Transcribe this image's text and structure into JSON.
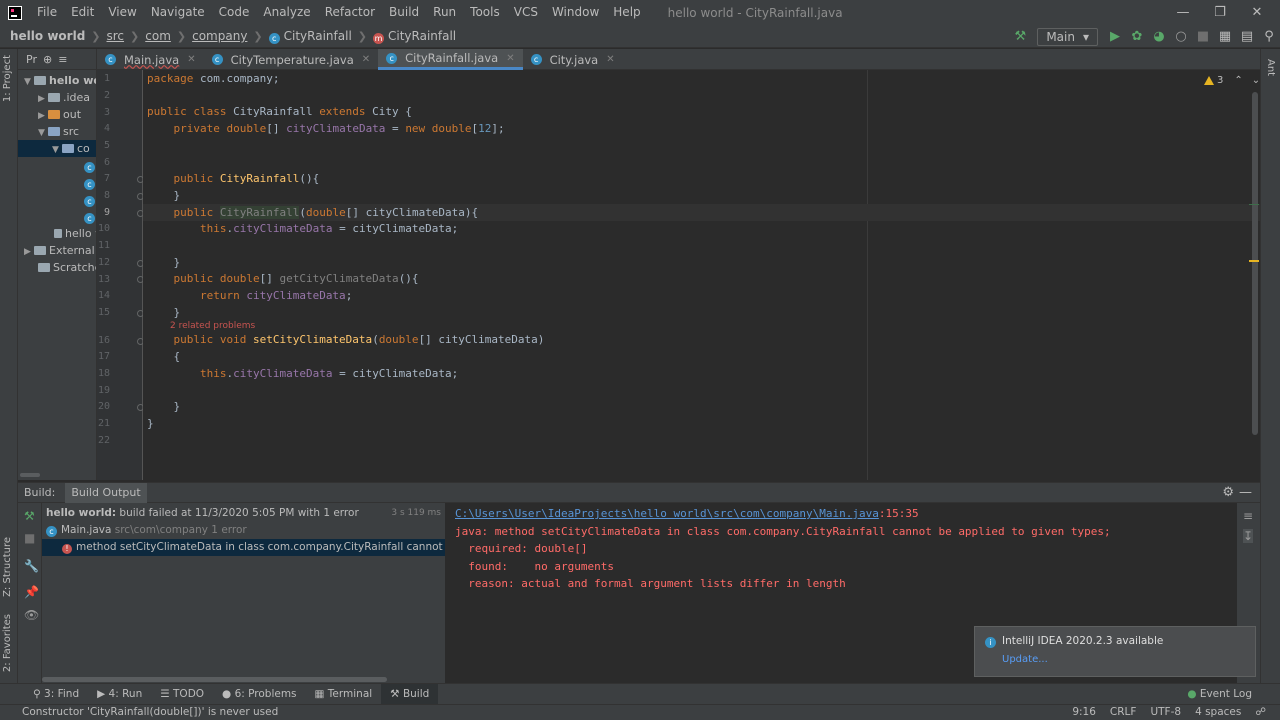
{
  "menu": [
    "File",
    "Edit",
    "View",
    "Navigate",
    "Code",
    "Analyze",
    "Refactor",
    "Build",
    "Run",
    "Tools",
    "VCS",
    "Window",
    "Help"
  ],
  "window_title": "hello world - CityRainfall.java",
  "breadcrumb": {
    "project": "hello world",
    "src": "src",
    "com": "com",
    "company": "company",
    "class": "CityRainfall",
    "method": "CityRainfall"
  },
  "run_config": "Main",
  "left_stripe": {
    "project": "1: Project",
    "structure": "Z: Structure",
    "favorites": "2: Favorites"
  },
  "right_stripe": {
    "ant": "Ant"
  },
  "project_panel": {
    "toolbar": "Pr",
    "tree": [
      "hello worl",
      ".idea",
      "out",
      "src",
      "co",
      "",
      "",
      "",
      "hello w",
      "External L",
      "Scratches"
    ]
  },
  "tabs": [
    "Main.java",
    "CityTemperature.java",
    "CityRainfall.java",
    "City.java"
  ],
  "editor": {
    "line_numbers": [
      "1",
      "2",
      "3",
      "4",
      "5",
      "6",
      "7",
      "8",
      "9",
      "10",
      "11",
      "12",
      "13",
      "14",
      "15",
      "16",
      "17",
      "18",
      "19",
      "20",
      "21",
      "22"
    ],
    "warnings": "3",
    "related_hint": "2 related problems",
    "lines": {
      "l1a": "package",
      "l1b": " com.company;",
      "l3a": "public class ",
      "l3b": "CityRainfall ",
      "l3c": "extends ",
      "l3d": "City {",
      "l4a": "    private double",
      "l4b": "[] ",
      "l4c": "cityClimateData",
      "l4d": " = ",
      "l4e": "new double",
      "l4f": "[",
      "l4g": "12",
      "l4h": "];",
      "l7a": "    public ",
      "l7b": "CityRainfall",
      "l7c": "(){",
      "l8": "    }",
      "l9a": "    public ",
      "l9b": "CityRainfall",
      "l9c": "(",
      "l9d": "double",
      "l9e": "[] cityClimateData){",
      "l10a": "        this",
      "l10b": ".",
      "l10c": "cityClimateData",
      "l10d": " = cityClimateData;",
      "l12": "    }",
      "l13a": "    public double",
      "l13b": "[] ",
      "l13c": "getCityClimateData",
      "l13d": "(){",
      "l14a": "        return ",
      "l14b": "cityClimateData",
      "l14c": ";",
      "l15": "    }",
      "l16a": "    public void ",
      "l16b": "setCityClimateData",
      "l16c": "(",
      "l16d": "double",
      "l16e": "[] cityClimateData)",
      "l17": "    {",
      "l18a": "        this",
      "l18b": ".",
      "l18c": "cityClimateData",
      "l18d": " = cityClimateData;",
      "l20": "    }",
      "l21": "}"
    }
  },
  "build": {
    "label": "Build:",
    "tab": "Build Output",
    "root": "hello world:",
    "root_rest": " build failed at 11/3/2020 5:05 PM with 1 error",
    "duration": "3 s 119 ms",
    "file": "Main.java",
    "file_path": " src\\com\\company 1 error",
    "error_item": "method setCityClimateData in class com.company.CityRainfall cannot be applied to",
    "output": {
      "link": "C:\\Users\\User\\IdeaProjects\\hello world\\src\\com\\company\\Main.java",
      "link_suffix": ":15:35",
      "l2": "java: method setCityClimateData in class com.company.CityRainfall cannot be applied to given types;",
      "l3": "  required: double[]",
      "l4": "  found:    no arguments",
      "l5": "  reason: actual and formal argument lists differ in length"
    }
  },
  "notification": {
    "title": "IntelliJ IDEA 2020.2.3 available",
    "link": "Update..."
  },
  "bottom_tabs": [
    "3: Find",
    "4: Run",
    "TODO",
    "6: Problems",
    "Terminal",
    "Build"
  ],
  "event_log": "Event Log",
  "status": {
    "message": "Constructor 'CityRainfall(double[])' is never used",
    "position": "9:16",
    "line_sep": "CRLF",
    "encoding": "UTF-8",
    "indent": "4 spaces"
  }
}
